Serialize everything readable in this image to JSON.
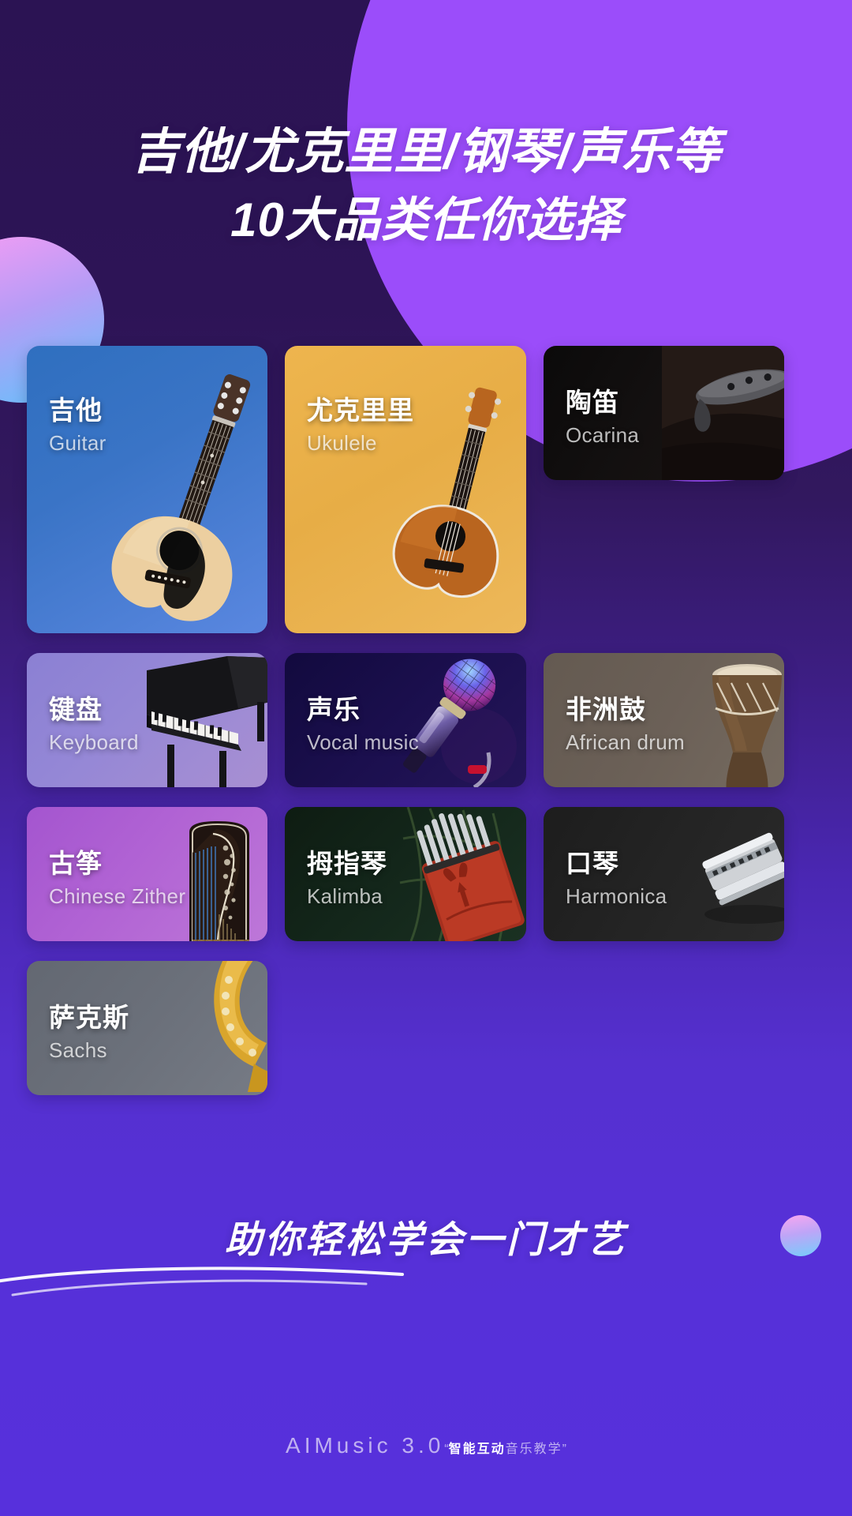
{
  "headline": {
    "line1": "吉他/尤克里里/钢琴/声乐等",
    "line2": "10大品类任你选择"
  },
  "cards": [
    {
      "cn": "吉他",
      "en": "Guitar",
      "icon": "acoustic-guitar-icon",
      "color": "#3a74c6"
    },
    {
      "cn": "尤克里里",
      "en": "Ukulele",
      "icon": "ukulele-icon",
      "color": "#e7ad46"
    },
    {
      "cn": "陶笛",
      "en": "Ocarina",
      "icon": "ocarina-icon",
      "color": "#131010"
    },
    {
      "cn": "非洲鼓",
      "en": "African drum",
      "icon": "djembe-drum-icon",
      "color": "#6b6057"
    },
    {
      "cn": "键盘",
      "en": "Keyboard",
      "icon": "grand-piano-icon",
      "color": "#9487d6"
    },
    {
      "cn": "声乐",
      "en": "Vocal music",
      "icon": "microphone-icon",
      "color": "#1b0f4e"
    },
    {
      "cn": "口琴",
      "en": "Harmonica",
      "icon": "harmonica-icon",
      "color": "#242424"
    },
    {
      "cn": "古筝",
      "en": "Chinese Zither",
      "icon": "guzheng-icon",
      "color": "#b163d4"
    },
    {
      "cn": "拇指琴",
      "en": "Kalimba",
      "icon": "kalimba-icon",
      "color": "#13261a"
    },
    {
      "cn": "萨克斯",
      "en": "Sachs",
      "icon": "saxophone-icon",
      "color": "#6b707a"
    }
  ],
  "tagline": "助你轻松学会一门才艺",
  "footer": {
    "brand": "AIMusic 3.0",
    "quote_open": "“",
    "accent": "智能互动",
    "tail": "音乐教学",
    "quote_close": "”"
  },
  "theme": {
    "bg_top": "#2b1353",
    "bg_bottom": "#5730dc",
    "blob_purple": "#9b4dfa",
    "accent_pink": "#f79df4",
    "accent_blue": "#62c2fb"
  }
}
